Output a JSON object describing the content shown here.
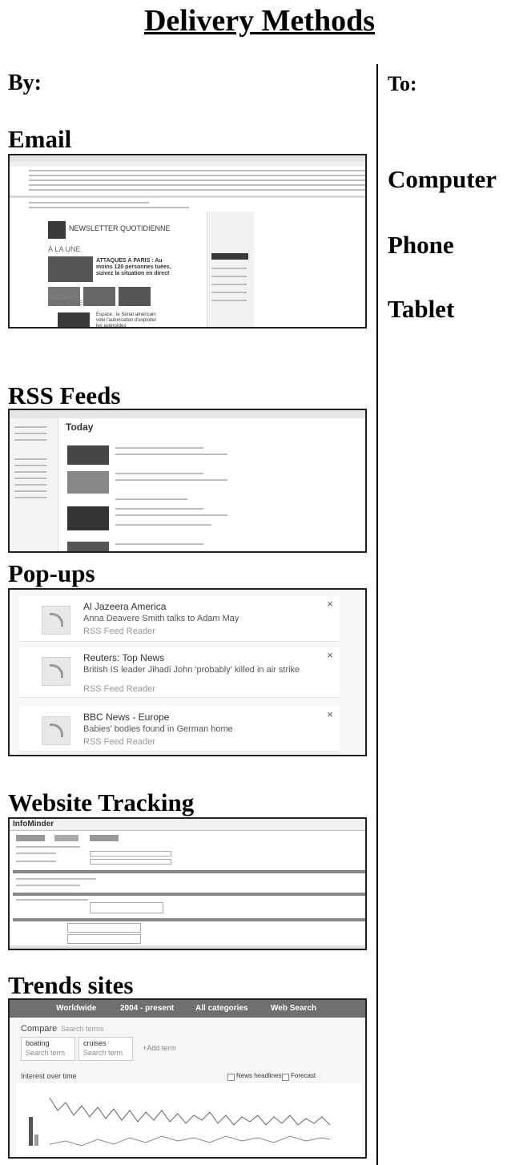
{
  "title": "Delivery Methods",
  "left_header": "By:",
  "right_header": "To:",
  "devices": [
    "Computer",
    "Phone",
    "Tablet"
  ],
  "sections": {
    "email": {
      "heading": "Email",
      "newsletter_title": "NEWSLETTER QUOTIDIENNE",
      "section_label": "À LA UNE",
      "headline": "ATTAQUES À PARIS : Au moins 120 personnes tuées, suivez la situation en direct",
      "economy_label": "ÉCONOMIE",
      "economy_headline": "Espace : le Sénat américain vote l'autorisation d'exploiter les astéroïdes"
    },
    "rss": {
      "heading": "RSS Feeds",
      "page_title": "Today"
    },
    "popups": {
      "heading": "Pop-ups",
      "items": [
        {
          "source": "Al Jazeera America",
          "headline": "Anna Deavere Smith talks to Adam May",
          "app": "RSS Feed Reader"
        },
        {
          "source": "Reuters: Top News",
          "headline": "British IS leader Jihadi John 'probably' killed in air strike",
          "app": "RSS Feed Reader"
        },
        {
          "source": "BBC News - Europe",
          "headline": "Babies' bodies found in German home",
          "app": "RSS Feed Reader"
        }
      ]
    },
    "tracking": {
      "heading": "Website Tracking",
      "app_name": "InfoMinder"
    },
    "trends": {
      "heading": "Trends sites",
      "nav": [
        "Worldwide",
        "2004 - present",
        "All categories",
        "Web Search"
      ],
      "compare_label": "Compare",
      "compare_hint": "Search terms",
      "terms": [
        "boating",
        "cruises",
        "+Add term"
      ],
      "term_hint": "Search term",
      "interest_label": "Interest over time",
      "options": [
        "News headlines",
        "Forecast"
      ]
    }
  }
}
